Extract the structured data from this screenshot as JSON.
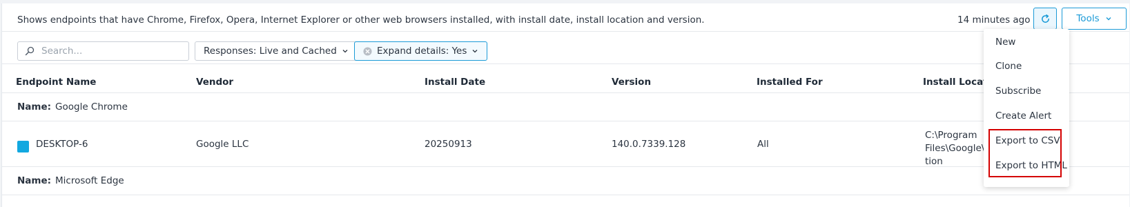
{
  "header": {
    "description": "Shows endpoints that have Chrome, Firefox, Opera, Internet Explorer or other web browsers installed, with install date, install location and version.",
    "updated": "14 minutes ago",
    "refresh_icon": "refresh-icon",
    "tools_label": "Tools"
  },
  "filters": {
    "search_placeholder": "Search...",
    "search_value": "",
    "responses": "Responses: Live and Cached",
    "expand": "Expand details: Yes"
  },
  "table": {
    "columns": [
      "Endpoint Name",
      "Vendor",
      "Install Date",
      "Version",
      "Installed For",
      "Install Location"
    ],
    "groups": [
      {
        "label": "Name:",
        "value": "Google Chrome",
        "rows": [
          {
            "endpoint": "DESKTOP-6",
            "vendor": "Google LLC",
            "install_date": "20250913",
            "version": "140.0.7339.128",
            "installed_for": "All",
            "location_lines": [
              "C:\\Program",
              "Files\\Google\\",
              "tion"
            ]
          }
        ]
      },
      {
        "label": "Name:",
        "value": "Microsoft Edge",
        "rows": []
      }
    ]
  },
  "tools_menu": {
    "items": [
      "New",
      "Clone",
      "Subscribe",
      "Create Alert",
      "Export to CSV",
      "Export to HTML"
    ]
  },
  "colors": {
    "accent": "#1a9ad7",
    "highlight": "#d40000",
    "os_badge": "#12a8e0"
  }
}
